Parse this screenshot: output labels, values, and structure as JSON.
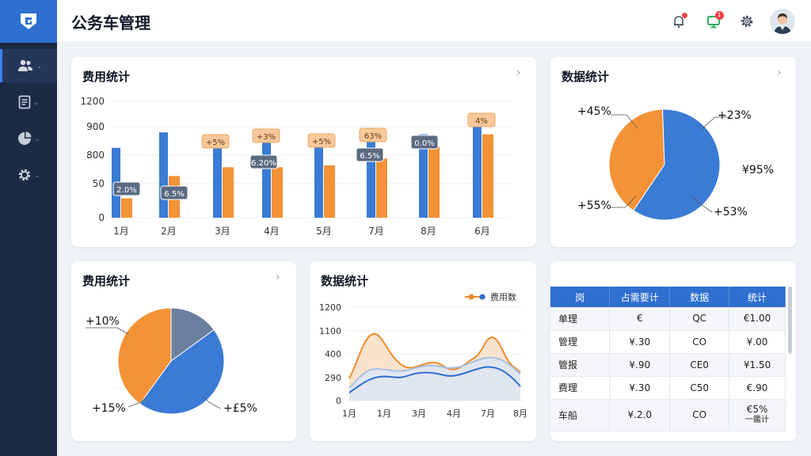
{
  "header": {
    "title": "公务车管理"
  },
  "sidebar": {
    "items": [
      {
        "icon": "users-icon"
      },
      {
        "icon": "document-icon"
      },
      {
        "icon": "pie-chart-icon"
      },
      {
        "icon": "gear-icon"
      }
    ]
  },
  "topbar": {
    "notification_badge": "•",
    "message_badge": "1"
  },
  "bar_card": {
    "title": "费用统计",
    "chart_data": {
      "type": "bar",
      "categories": [
        "1月",
        "2月",
        "3月",
        "4月",
        "5月",
        "7月",
        "8月",
        "6月"
      ],
      "y_ticks": [
        "1200",
        "900",
        "800",
        "50",
        "0"
      ],
      "series": [
        {
          "values": [
            720,
            880,
            790,
            860,
            810,
            790,
            860,
            1000
          ],
          "color": "#3a7bd5"
        },
        {
          "values": [
            200,
            430,
            520,
            520,
            540,
            610,
            730,
            860
          ],
          "color": "#f39237"
        }
      ],
      "annotations": [
        "2.0%",
        "6.5%",
        "+5%",
        "+3%",
        "+5%",
        "63%",
        "0.0%",
        "4%",
        "6.20%",
        "6.5%"
      ]
    }
  },
  "pie_card_top": {
    "title": "数据统计",
    "labels": [
      "+45%",
      "+23%",
      "¥95%",
      "+55%",
      "+53%"
    ],
    "chart_data": {
      "type": "pie",
      "values": [
        40,
        60
      ],
      "colors": [
        "#f39237",
        "#3a7bd5"
      ]
    }
  },
  "pie_card_bottom": {
    "title": "费用统计",
    "labels": [
      "+10%",
      "+15%",
      "+£5%"
    ],
    "chart_data": {
      "type": "pie",
      "values": [
        40,
        15,
        45
      ],
      "colors": [
        "#f39237",
        "#6b7fa0",
        "#3a7bd5"
      ]
    }
  },
  "line_card": {
    "title": "数据统计",
    "legend": "费用数",
    "chart_data": {
      "type": "area",
      "categories": [
        "1月",
        "1月",
        "3月",
        "4月",
        "7月",
        "8月"
      ],
      "y_ticks": [
        "1200",
        "1100",
        "400",
        "290",
        "0"
      ]
    }
  },
  "table": {
    "headers": [
      "岗",
      "占需要计",
      "数据",
      "统计"
    ],
    "rows": [
      [
        "单理",
        "€",
        "QC",
        "€1.00"
      ],
      [
        "管理",
        "¥.30",
        "CO",
        "¥.00"
      ],
      [
        "管报",
        "¥.90",
        "CE0",
        "¥1.50"
      ],
      [
        "费理",
        "¥.30",
        "C50",
        "€.90"
      ],
      [
        "车船",
        "¥.2.0",
        "CO",
        "€5%"
      ]
    ],
    "last_note": "一鑑计"
  }
}
